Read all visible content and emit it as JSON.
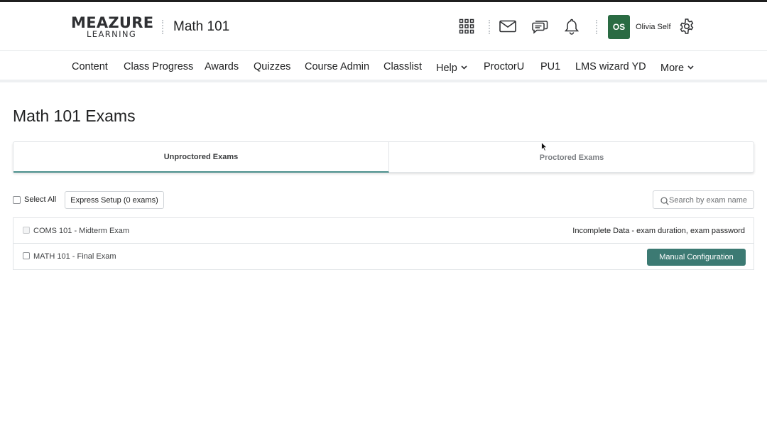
{
  "header": {
    "logo_top": "MEAZURE",
    "logo_bottom": "LEARNING",
    "course_title": "Math 101",
    "icons": [
      "apps-grid-icon",
      "mail-icon",
      "chat-icon",
      "bell-icon",
      "gear-icon"
    ],
    "user": {
      "initials": "OS",
      "name": "Olivia Self",
      "avatar_color": "#2a6b43"
    }
  },
  "nav": {
    "items": [
      {
        "label": "Content"
      },
      {
        "label": "Class Progress"
      },
      {
        "label": "Awards"
      },
      {
        "label": "Quizzes"
      },
      {
        "label": "Course Admin"
      },
      {
        "label": "Classlist"
      },
      {
        "label": "Help",
        "dropdown": true
      },
      {
        "label": "ProctorU"
      },
      {
        "label": "PU1"
      },
      {
        "label": "LMS wizard YD"
      },
      {
        "label": "More",
        "dropdown": true
      }
    ]
  },
  "main": {
    "page_title": "Math 101 Exams",
    "tabs": [
      {
        "label": "Unproctored Exams",
        "active": true
      },
      {
        "label": "Proctored Exams",
        "active": false
      }
    ],
    "toolbar": {
      "select_all_label": "Select All",
      "express_setup_label": "Express Setup (0 exams)",
      "search_placeholder": "Search by exam name"
    },
    "exams": [
      {
        "name": "COMS 101 - Midterm Exam",
        "status": "Incomplete Data - exam duration, exam password",
        "checkbox_disabled": true
      },
      {
        "name": "MATH 101 - Final Exam",
        "action_label": "Manual Configuration",
        "checkbox_disabled": false
      }
    ]
  },
  "colors": {
    "accent": "#3c7a73",
    "active_tab_underline": "#4b8f8c",
    "avatar": "#2a6b43"
  }
}
